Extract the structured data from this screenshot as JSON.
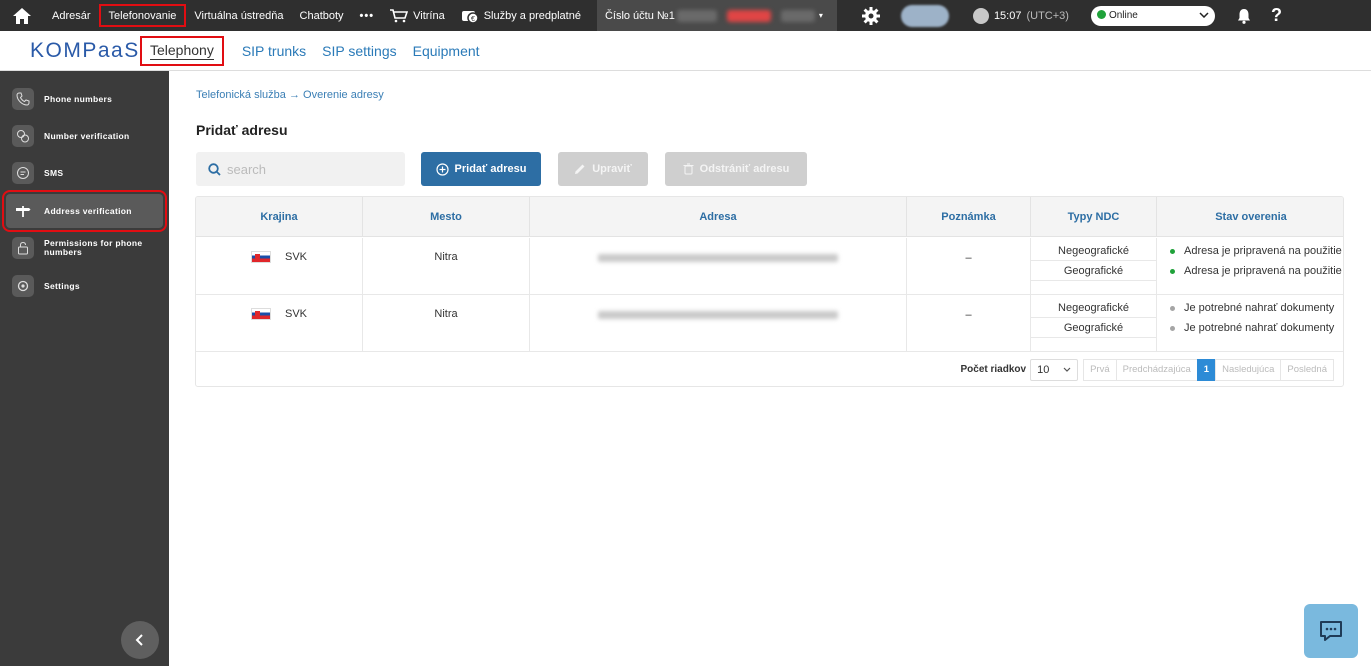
{
  "topbar": {
    "nav": [
      "Adresár",
      "Telefonovanie",
      "Virtuálna ústredňa",
      "Chatboty",
      "•••",
      "Vitrína",
      "Služby a predplatné"
    ],
    "account_label": "Číslo účtu №1",
    "time": "15:07",
    "timezone": "(UTC+3)",
    "status": "Online",
    "help": "?"
  },
  "subheader": {
    "logo": "KOMPaaS",
    "tabs": [
      "Telephony",
      "SIP trunks",
      "SIP settings",
      "Equipment"
    ]
  },
  "sidebar": {
    "items": [
      "Phone numbers",
      "Number verification",
      "SMS",
      "Address verification",
      "Permissions for phone numbers",
      "Settings"
    ]
  },
  "breadcrumb": {
    "root": "Telefonická služba",
    "arrow": "→",
    "current": "Overenie adresy"
  },
  "page_title": "Pridať adresu",
  "search": {
    "placeholder": "search"
  },
  "buttons": {
    "add": "Pridať adresu",
    "edit": "Upraviť",
    "delete": "Odstrániť adresu"
  },
  "table": {
    "headers": [
      "Krajina",
      "Mesto",
      "Adresa",
      "Poznámka",
      "Typy NDC",
      "Stav overenia"
    ],
    "rows": [
      {
        "country": "SVK",
        "city": "Nitra",
        "note": "–",
        "ndc": [
          "Negeografické",
          "Geografické"
        ],
        "status": [
          "Adresa je pripravená na použitie",
          "Adresa je pripravená na použitie"
        ],
        "status_color": "#1fa23a"
      },
      {
        "country": "SVK",
        "city": "Nitra",
        "note": "–",
        "ndc": [
          "Negeografické",
          "Geografické"
        ],
        "status": [
          "Je potrebné nahrať dokumenty",
          "Je potrebné nahrať dokumenty"
        ],
        "status_color": "#a5a5a5"
      }
    ]
  },
  "pagination": {
    "rows_label": "Počet riadkov",
    "rows_value": "10",
    "first": "Prvá",
    "prev": "Predchádzajúca",
    "current": "1",
    "next": "Nasledujúca",
    "last": "Posledná"
  },
  "colors": {
    "accent": "#2d6ea4",
    "highlight": "#e10d12",
    "sidebar": "#3b3b3b",
    "topbar": "#2f2f2f"
  }
}
